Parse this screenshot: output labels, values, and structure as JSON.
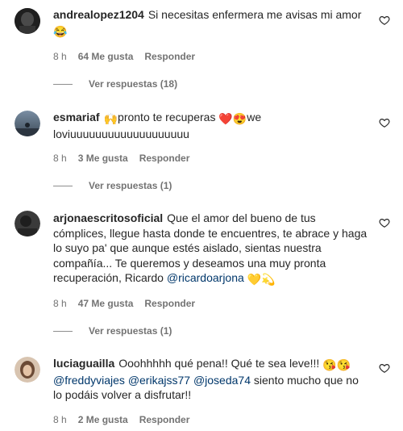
{
  "comments": [
    {
      "username": "andrealopez1204",
      "text": "Si necesitas enfermera me avisas mi amor",
      "emoji": "😂",
      "time": "8 h",
      "likes": "64 Me gusta",
      "reply": "Responder",
      "view_replies": "Ver respuestas (18)"
    },
    {
      "username": "esmariaf",
      "text_prefix_emoji": "🙌",
      "text": "pronto te recuperas",
      "emoji": "❤️😍",
      "text_suffix": "we loviuuuuuuuuuuuuuuuuuuu",
      "time": "8 h",
      "likes": "3 Me gusta",
      "reply": "Responder",
      "view_replies": "Ver respuestas (1)"
    },
    {
      "username": "arjonaescritosoficial",
      "text": "Que el amor del bueno de tus cómplices, llegue hasta donde te encuentres, te abrace y haga lo suyo pa' que aunque estés aislado, sientas nuestra compañía... Te queremos y deseamos una muy pronta recuperación, Ricardo",
      "mention": "@ricardoarjona",
      "emoji": "💛💫",
      "time": "8 h",
      "likes": "47 Me gusta",
      "reply": "Responder",
      "view_replies": "Ver respuestas (1)"
    },
    {
      "username": "luciaguailla",
      "text": "Ooohhhhh qué pena!! Qué te sea leve!!!",
      "emoji": "😘😘",
      "mentions": [
        "@freddyviajes",
        "@erikajss77",
        "@joseda74"
      ],
      "text_suffix": "siento mucho que no lo podáis volver a disfrutar!!",
      "time": "8 h",
      "likes": "2 Me gusta",
      "reply": "Responder"
    }
  ],
  "icons": {
    "like": "heart-outline-icon",
    "avatar_colors": [
      "#2a2a2a",
      "#5a6a78",
      "#3a3a3a",
      "#b28a6a"
    ]
  }
}
